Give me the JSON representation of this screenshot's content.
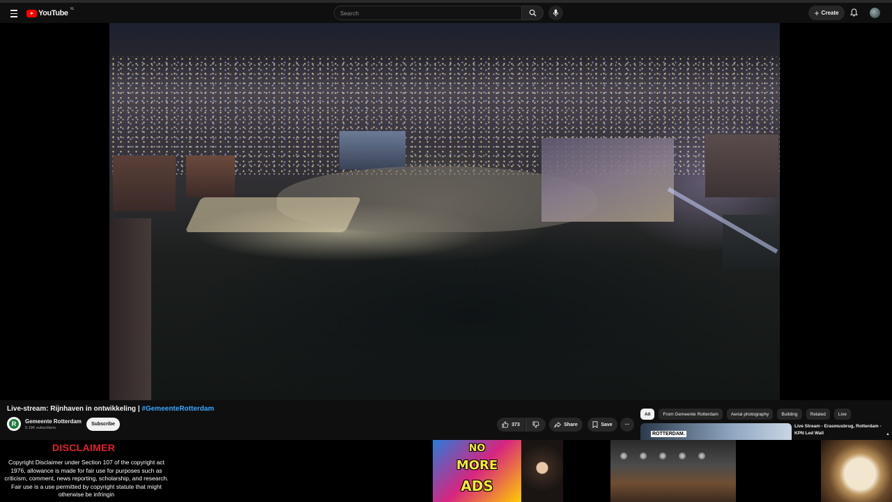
{
  "header": {
    "logo_text": "YouTube",
    "logo_region": "NL",
    "search_placeholder": "Search",
    "create_label": "Create",
    "icons": [
      "menu-icon",
      "search-icon",
      "mic-icon",
      "plus-icon",
      "bell-icon"
    ]
  },
  "video": {
    "title_main": "Live-stream: Rijnhaven in ontwikkeling | ",
    "title_hashtag": "#GemeenteRotterdam",
    "channel_name": "Gemeente Rotterdam",
    "subscribers": "5.19K subscribers",
    "subscribe_label": "Subscribe",
    "like_count": "373",
    "share_label": "Share",
    "save_label": "Save",
    "more_label": "···"
  },
  "sidebar": {
    "chips": [
      {
        "label": "All",
        "active": true
      },
      {
        "label": "From Gemeente Rotterdam",
        "active": false
      },
      {
        "label": "Aerial photography",
        "active": false
      },
      {
        "label": "Building",
        "active": false
      },
      {
        "label": "Related",
        "active": false
      },
      {
        "label": "Live",
        "active": false
      }
    ],
    "recommendation": {
      "thumb_label": "ROTTERDAM.",
      "title": "Live Stream - Erasmusbrug, Rotterdam - KPN Led Wall"
    }
  },
  "overlay": {
    "disclaimer_title": "DISCLAIMER",
    "disclaimer_text": "Copyright Disclaimer under Section 107 of the copyright act 1976, allowance is made for fair use for purposes such as criticism, comment, news reporting, scholarship, and research. Fair use is a use permitted by copyright statute that might otherwise be infringin",
    "graffiti_lines": [
      "NO",
      "MORE",
      "ADS"
    ]
  },
  "colors": {
    "background": "#0f0f0f",
    "youtube_red": "#ff0000",
    "link_blue": "#3ea6ff",
    "disclaimer_red": "#e4202a"
  }
}
